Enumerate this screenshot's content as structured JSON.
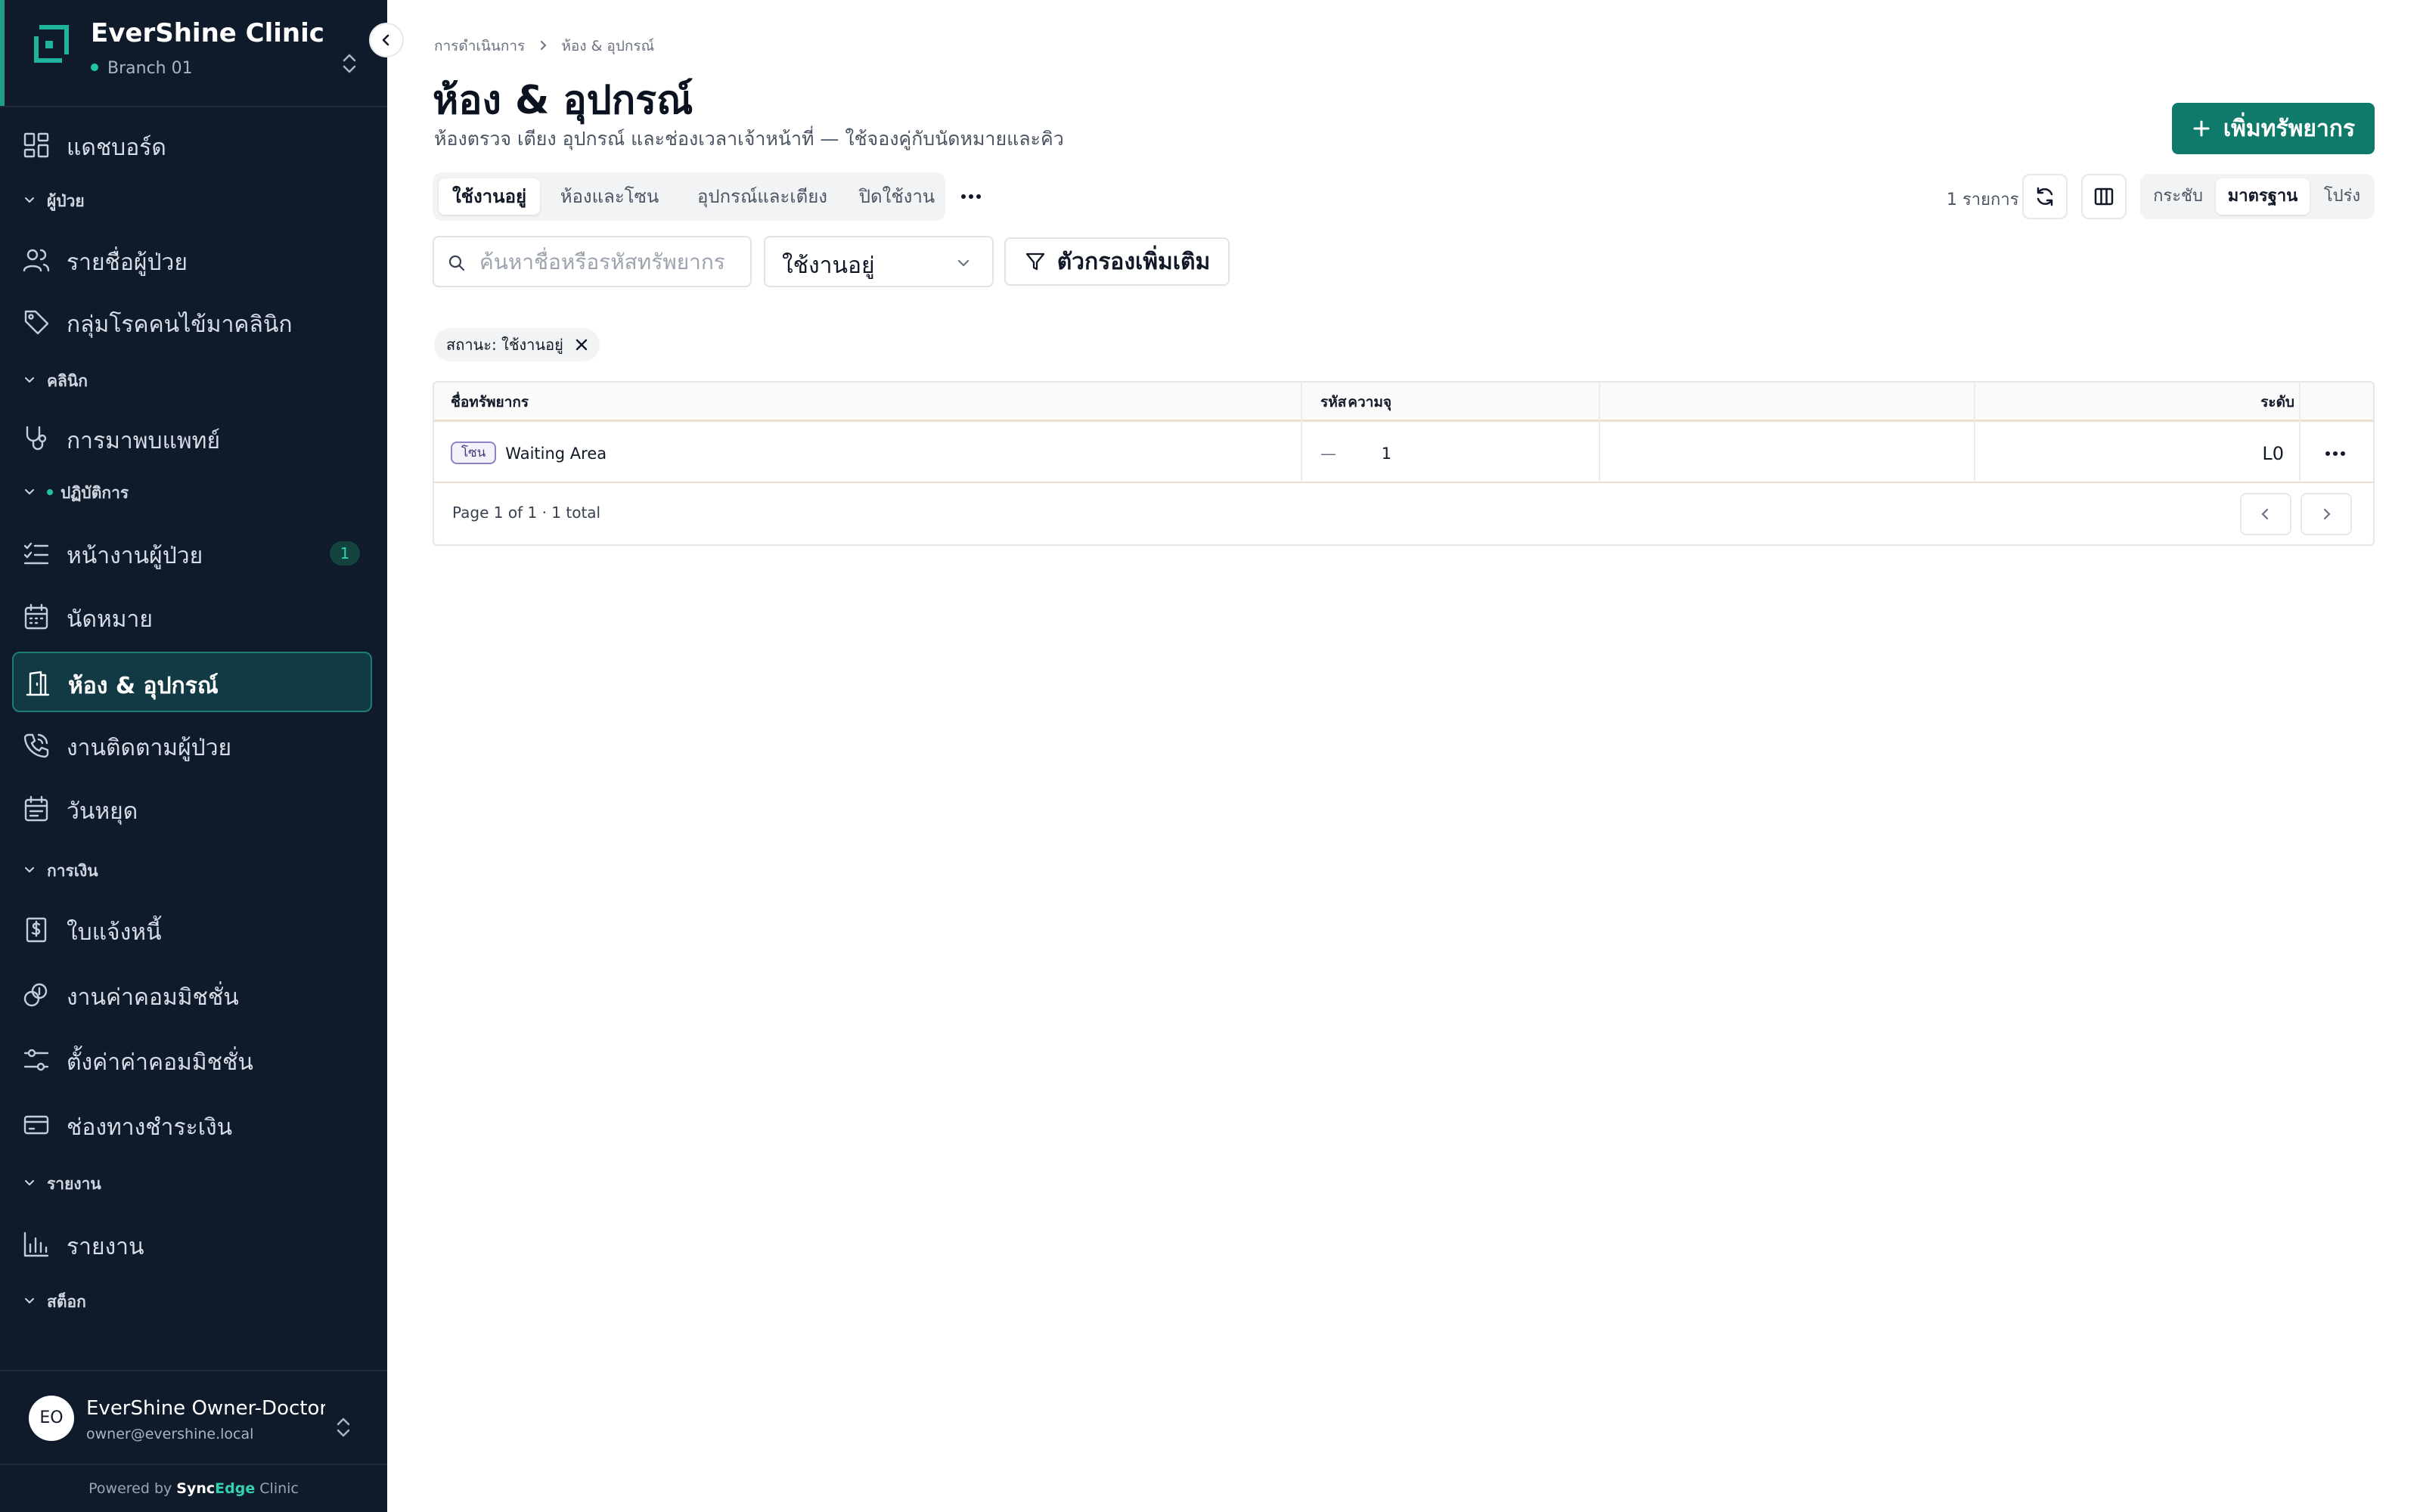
{
  "app": {
    "name": "EverShine Clinic",
    "branch": "Branch 01"
  },
  "sidebar": {
    "items": [
      {
        "type": "item",
        "label": "แดชบอร์ด",
        "icon": "dashboard-icon"
      },
      {
        "type": "section",
        "label": "ผู้ป่วย"
      },
      {
        "type": "item",
        "label": "รายชื่อผู้ป่วย",
        "icon": "users-icon"
      },
      {
        "type": "item",
        "label": "กลุ่มโรคคนไข้มาคลินิก",
        "icon": "tag-icon"
      },
      {
        "type": "section",
        "label": "คลินิก"
      },
      {
        "type": "item",
        "label": "การมาพบแพทย์",
        "icon": "stethoscope-icon"
      },
      {
        "type": "section",
        "label": "ปฏิบัติการ"
      },
      {
        "type": "item",
        "label": "หน้างานผู้ป่วย",
        "icon": "checklist-icon",
        "badge": "1"
      },
      {
        "type": "item",
        "label": "นัดหมาย",
        "icon": "calendar-icon"
      },
      {
        "type": "item",
        "label": "ห้อง & อุปกรณ์",
        "icon": "door-icon",
        "active": true
      },
      {
        "type": "item",
        "label": "งานติดตามผู้ป่วย",
        "icon": "phone-icon"
      },
      {
        "type": "item",
        "label": "วันหยุด",
        "icon": "calendar-off-icon"
      },
      {
        "type": "section",
        "label": "การเงิน"
      },
      {
        "type": "item",
        "label": "ใบแจ้งหนี้",
        "icon": "invoice-icon"
      },
      {
        "type": "item",
        "label": "งานค่าคอมมิชชั่น",
        "icon": "coins-icon"
      },
      {
        "type": "item",
        "label": "ตั้งค่าค่าคอมมิชชั่น",
        "icon": "sliders-icon"
      },
      {
        "type": "item",
        "label": "ช่องทางชำระเงิน",
        "icon": "credit-card-icon"
      },
      {
        "type": "section",
        "label": "รายงาน"
      },
      {
        "type": "item",
        "label": "รายงาน",
        "icon": "bar-chart-icon"
      },
      {
        "type": "section",
        "label": "สต็อก"
      }
    ]
  },
  "user": {
    "initials": "EO",
    "name": "EverShine Owner-Doctor",
    "email": "owner@evershine.local"
  },
  "footer": {
    "powered_prefix": "Powered by",
    "brand_a": "Sync",
    "brand_b": "Edge",
    "brand_c": "Clinic"
  },
  "breadcrumb": {
    "parent": "การดำเนินการ",
    "current": "ห้อง & อุปกรณ์"
  },
  "page": {
    "title": "ห้อง & อุปกรณ์",
    "subtitle": "ห้องตรวจ เตียง อุปกรณ์ และช่องเวลาเจ้าหน้าที่ — ใช้จองคู่กับนัดหมายและคิว",
    "add_label": "เพิ่มทรัพยากร"
  },
  "tabs": [
    "ใช้งานอยู่",
    "ห้องและโซน",
    "อุปกรณ์และเตียง",
    "ปิดใช้งาน"
  ],
  "toolbar": {
    "count": "1 รายการ",
    "density": [
      "กระชับ",
      "มาตรฐาน",
      "โปร่ง"
    ]
  },
  "filters": {
    "search_placeholder": "ค้นหาชื่อหรือรหัสทรัพยากร",
    "status_value": "ใช้งานอยู่",
    "more_label": "ตัวกรองเพิ่มเติม",
    "chip": "สถานะ: ใช้งานอยู่"
  },
  "table": {
    "headers": {
      "name": "ชื่อทรัพยากร",
      "code": "รหัส",
      "capacity": "ความจุ",
      "level": "ระดับ"
    },
    "rows": [
      {
        "type": "โซน",
        "name": "Waiting Area",
        "code": "—",
        "capacity": "1",
        "level": "L0"
      }
    ],
    "pager": "Page 1 of 1 · 1 total"
  },
  "colors": {
    "sidebar_bg": "#0f1a2a",
    "accent": "#0f7a6a",
    "active_bg": "#113a44"
  }
}
